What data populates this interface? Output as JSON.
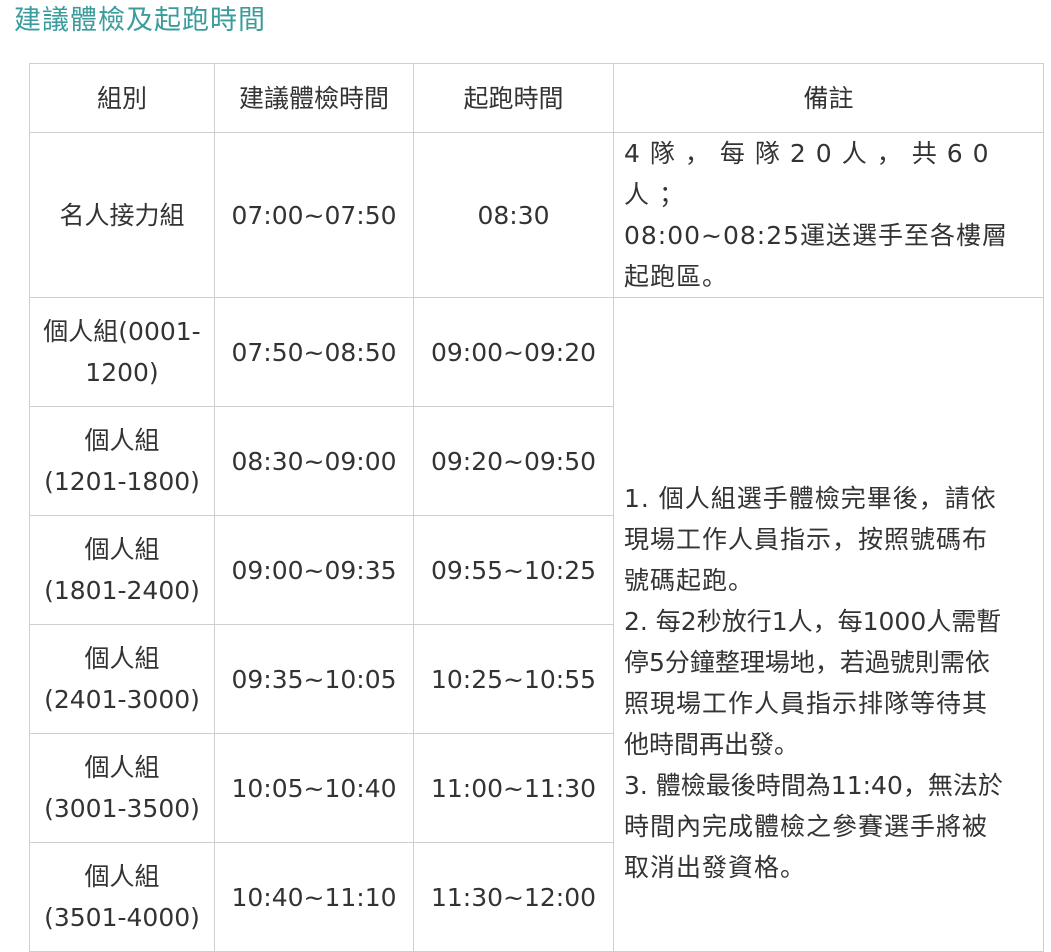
{
  "page": {
    "title": "建議體檢及起跑時間"
  },
  "table": {
    "headers": [
      "組別",
      "建議體檢時間",
      "起跑時間",
      "備註"
    ],
    "celebrity": {
      "group": "名人接力組",
      "checkup": "07:00~07:50",
      "start": "08:30",
      "note_line1": "4隊，每隊20人，共60人；",
      "note_line2": "08:00~08:25運送選手至各樓層",
      "note_line3": "起跑區。"
    },
    "rows": [
      {
        "group_line1": "個人組(0001-",
        "group_line2": "1200)",
        "checkup": "07:50~08:50",
        "start": "09:00~09:20"
      },
      {
        "group_line1": "個人組",
        "group_line2": "(1201-1800)",
        "checkup": "08:30~09:00",
        "start": "09:20~09:50"
      },
      {
        "group_line1": "個人組",
        "group_line2": "(1801-2400)",
        "checkup": "09:00~09:35",
        "start": "09:55~10:25"
      },
      {
        "group_line1": "個人組",
        "group_line2": "(2401-3000)",
        "checkup": "09:35~10:05",
        "start": "10:25~10:55"
      },
      {
        "group_line1": "個人組",
        "group_line2": "(3001-3500)",
        "checkup": "10:05~10:40",
        "start": "11:00~11:30"
      },
      {
        "group_line1": "個人組",
        "group_line2": "(3501-4000)",
        "checkup": "10:40~11:10",
        "start": "11:30~12:00"
      }
    ],
    "individual_notes": [
      "1. 個人組選手體檢完畢後，請依",
      "現場工作人員指示，按照號碼布",
      "號碼起跑。",
      "2. 每2秒放行1人，每1000人需暫",
      "停5分鐘整理場地，若過號則需依",
      "照現場工作人員指示排隊等待其",
      "他時間再出發。",
      "3. 體檢最後時間為11:40，無法於",
      "時間內完成體檢之參賽選手將被",
      "取消出發資格。"
    ]
  }
}
